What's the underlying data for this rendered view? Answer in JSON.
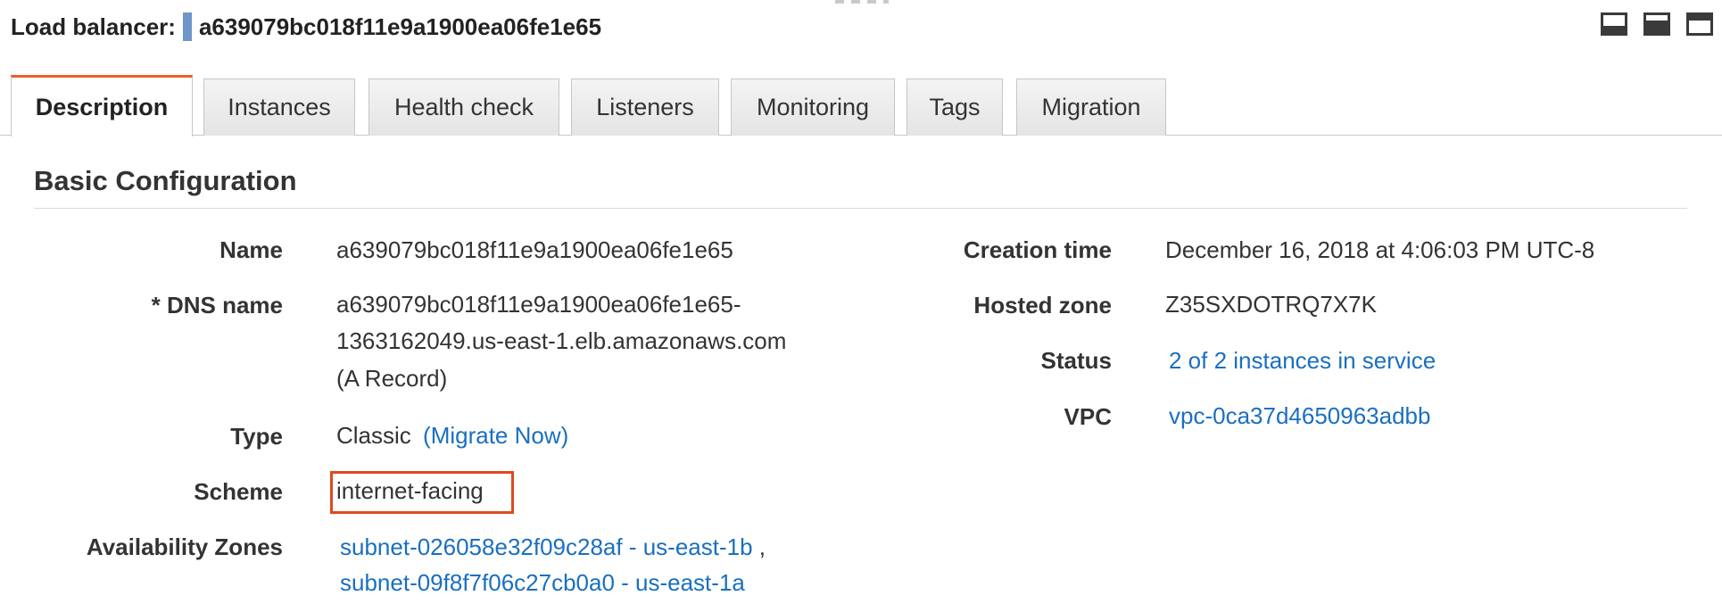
{
  "header": {
    "label": "Load balancer:",
    "id": "a639079bc018f11e9a1900ea06fe1e65"
  },
  "view_buttons": [
    "bottom-panel-icon",
    "split-panel-icon",
    "top-panel-icon"
  ],
  "tabs": [
    {
      "label": "Description",
      "active": true
    },
    {
      "label": "Instances",
      "active": false
    },
    {
      "label": "Health check",
      "active": false
    },
    {
      "label": "Listeners",
      "active": false
    },
    {
      "label": "Monitoring",
      "active": false
    },
    {
      "label": "Tags",
      "active": false
    },
    {
      "label": "Migration",
      "active": false
    }
  ],
  "section": {
    "title": "Basic Configuration"
  },
  "left_fields": {
    "name": {
      "label": "Name",
      "value": "a639079bc018f11e9a1900ea06fe1e65"
    },
    "dns": {
      "label": "* DNS name",
      "line1": "a639079bc018f11e9a1900ea06fe1e65-",
      "line2": "1363162049.us-east-1.elb.amazonaws.com",
      "line3": "(A Record)"
    },
    "type": {
      "label": "Type",
      "value": "Classic",
      "link": "(Migrate Now)"
    },
    "scheme": {
      "label": "Scheme",
      "value": "internet-facing"
    },
    "zones": {
      "label": "Availability Zones",
      "items": [
        "subnet-026058e32f09c28af - us-east-1b",
        "subnet-09f8f7f06c27cb0a0 - us-east-1a"
      ],
      "separator": ","
    }
  },
  "right_fields": {
    "creation": {
      "label": "Creation time",
      "value": "December 16, 2018 at 4:06:03 PM UTC-8"
    },
    "hosted_zone": {
      "label": "Hosted zone",
      "value": "Z35SXDOTRQ7X7K"
    },
    "status": {
      "label": "Status",
      "value": "2 of 2 instances in service"
    },
    "vpc": {
      "label": "VPC",
      "value": "vpc-0ca37d4650963adbb"
    }
  },
  "colors": {
    "link": "#1a6fc1",
    "active_tab_accent": "#e8602c",
    "highlight_box": "#e0491f"
  }
}
